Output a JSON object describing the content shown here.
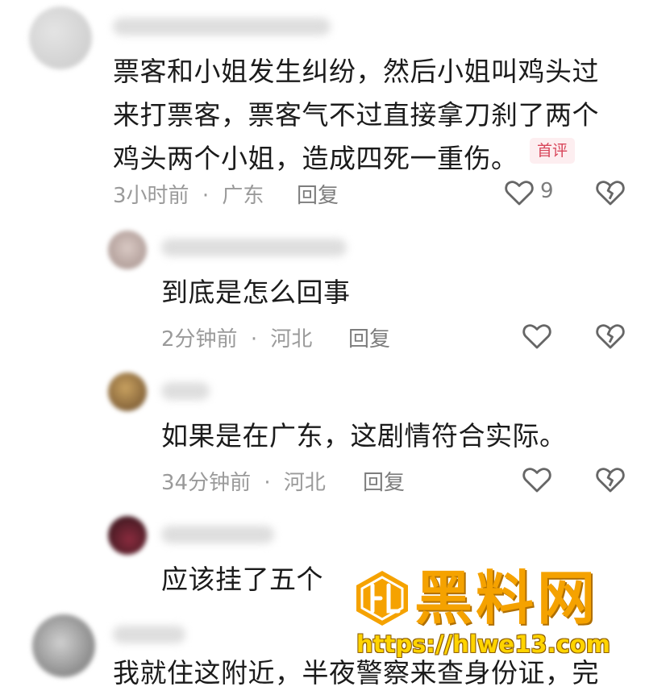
{
  "comments": [
    {
      "text_lines": [
        "票客和小姐发生纠纷，然后小姐叫鸡头过",
        "来打票客，票客气不过直接拿刀刹了两个",
        "鸡头两个小姐，造成四死一重伤。"
      ],
      "badge": "首评",
      "time": "3小时前",
      "location": "广东",
      "reply": "回复",
      "likes": "9"
    },
    {
      "text": "到底是怎么回事",
      "time": "2分钟前",
      "location": "河北",
      "reply": "回复"
    },
    {
      "text": "如果是在广东，这剧情符合实际。",
      "time": "34分钟前",
      "location": "河北",
      "reply": "回复"
    },
    {
      "text": "应该挂了五个"
    },
    {
      "text": "我就住这附近，半夜警察来查身份证，完"
    }
  ],
  "meta_separator": "·",
  "watermark": {
    "brand": "黑料网",
    "url": "https://hlwe13.com",
    "colors": {
      "orange": "#f5a200",
      "yellow": "#ffd400"
    }
  },
  "icons": {
    "like": "heart-outline-icon",
    "dislike": "broken-heart-icon"
  }
}
